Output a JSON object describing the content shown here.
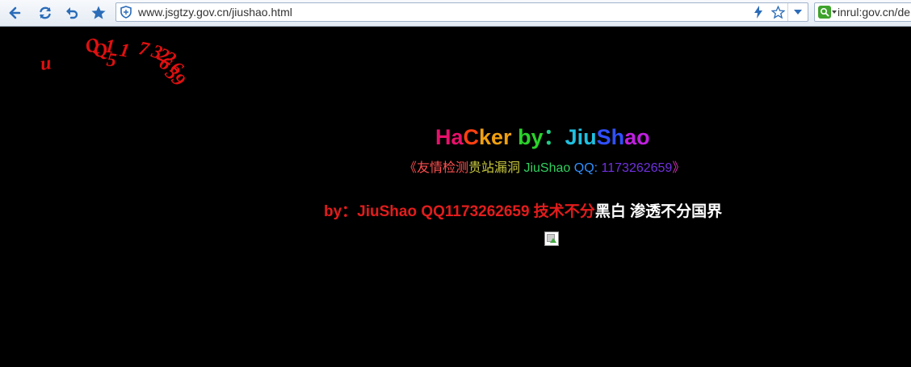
{
  "browser": {
    "url": "www.jsgtzy.gov.cn/jiushao.html",
    "search_text": "inrul:gov.cn/de"
  },
  "cursor_trail": {
    "color": "#e01010",
    "chars": [
      "u",
      "Q",
      "Q",
      "1",
      "1",
      "5",
      "7",
      "3",
      "2",
      "2",
      "6",
      "6",
      "5",
      "9"
    ]
  },
  "page": {
    "title": {
      "segments": [
        {
          "text": "Ha",
          "color": "#e8106a"
        },
        {
          "text": "C",
          "color": "#ff4010"
        },
        {
          "text": "ker ",
          "color": "#f0a010"
        },
        {
          "text": "by",
          "color": "#2ad12a"
        },
        {
          "text": "：",
          "color": "#22cc88"
        },
        {
          "text": "Jiu",
          "color": "#20c0e0"
        },
        {
          "text": "Sh",
          "color": "#3050ff"
        },
        {
          "text": "ao",
          "color": "#c020e0"
        }
      ]
    },
    "subtitle": {
      "segments": [
        {
          "text": "《友情检测",
          "color": "#ff5050"
        },
        {
          "text": "贵站漏洞 ",
          "color": "#c8c840"
        },
        {
          "text": "JiuShao",
          "color": "#30d060"
        },
        {
          "text": " QQ: ",
          "color": "#3090ff"
        },
        {
          "text": "1173262659",
          "color": "#7030e0"
        },
        {
          "text": "》",
          "color": "#e030c0"
        }
      ]
    },
    "slogan": {
      "red_part": "by：JiuShao QQ1173262659 技术不分",
      "white_part": "黑白 渗透不分国界"
    }
  }
}
